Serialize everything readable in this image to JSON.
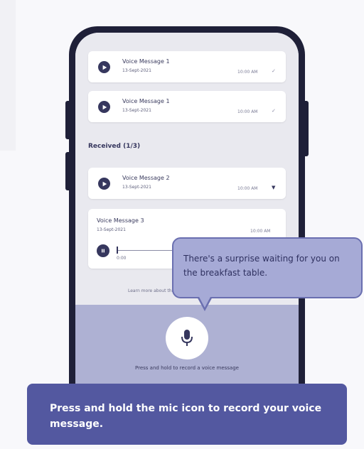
{
  "messages_sent": [
    {
      "title": "Voice Message 1",
      "date": "13-Sept-2021",
      "time": "10:00 AM",
      "status": "✓"
    },
    {
      "title": "Voice Message 1",
      "date": "13-Sept-2021",
      "time": "10:00 AM",
      "status": "✓"
    }
  ],
  "received_section": {
    "label": "Received (1/3)"
  },
  "messages_received": [
    {
      "title": "Voice Message 2",
      "date": "13-Sept-2021",
      "time": "10:00 AM",
      "status": "▼"
    }
  ],
  "expanded_message": {
    "title": "Voice Message 3",
    "date": "13-Sept-2021",
    "time": "10:00 AM",
    "elapsed": "0:00",
    "progress": 0.02
  },
  "learn_more_text": "Learn more about this",
  "record_hint": "Press and hold to record a voice message",
  "tooltip": {
    "text": "There's a surprise waiting for you on the breakfast table."
  },
  "banner": {
    "text": "Press and hold the mic icon to record your voice message."
  },
  "colors": {
    "accent": "#5358a0",
    "tooltip_bg": "#a6aad6",
    "dark": "#36375e"
  },
  "icons": {
    "play": "play-icon",
    "pause": "pause-icon",
    "mic": "mic-icon",
    "tick": "check-icon",
    "dropdown": "chevron-down-icon"
  }
}
